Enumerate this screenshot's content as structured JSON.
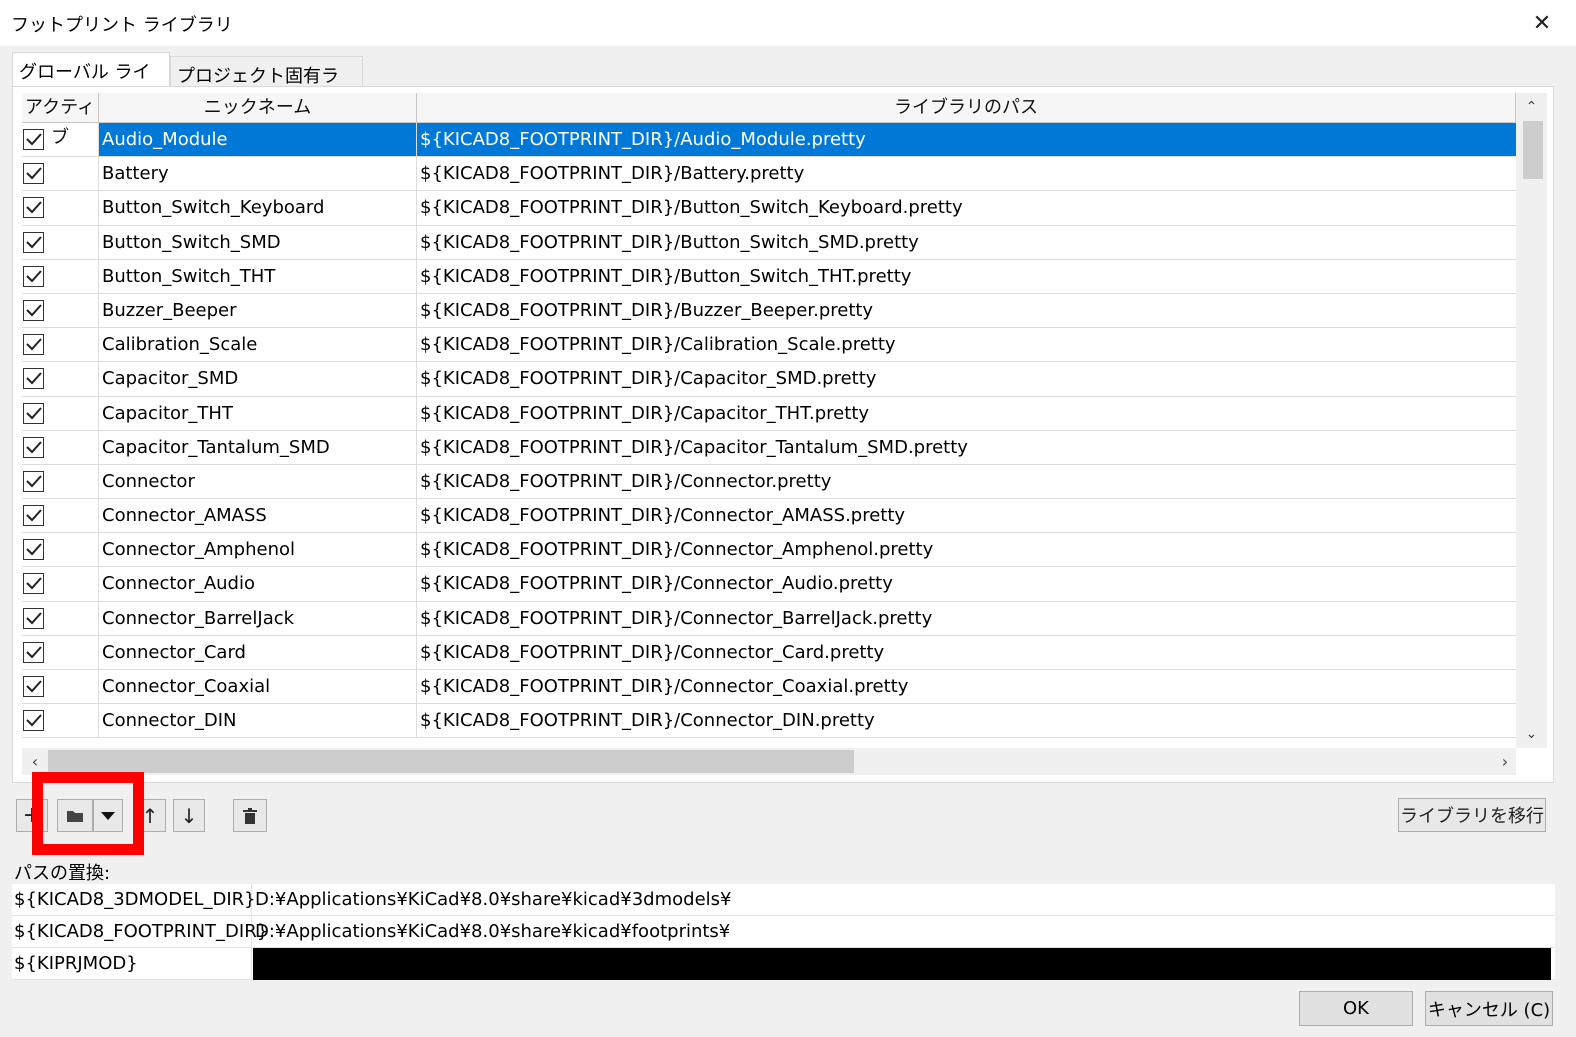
{
  "window": {
    "title": "フットプリント ライブラリ",
    "close_icon": "close-icon"
  },
  "tabs": [
    {
      "label": "グローバル ライブラリ",
      "active": true
    },
    {
      "label": "プロジェクト固有ライブラリ",
      "active": false
    }
  ],
  "table": {
    "headers": [
      "アクティブ",
      "ニックネーム",
      "ライブラリのパス"
    ],
    "rows": [
      {
        "active": true,
        "nickname": "Audio_Module",
        "path": "${KICAD8_FOOTPRINT_DIR}/Audio_Module.pretty",
        "selected": true
      },
      {
        "active": true,
        "nickname": "Battery",
        "path": "${KICAD8_FOOTPRINT_DIR}/Battery.pretty"
      },
      {
        "active": true,
        "nickname": "Button_Switch_Keyboard",
        "path": "${KICAD8_FOOTPRINT_DIR}/Button_Switch_Keyboard.pretty"
      },
      {
        "active": true,
        "nickname": "Button_Switch_SMD",
        "path": "${KICAD8_FOOTPRINT_DIR}/Button_Switch_SMD.pretty"
      },
      {
        "active": true,
        "nickname": "Button_Switch_THT",
        "path": "${KICAD8_FOOTPRINT_DIR}/Button_Switch_THT.pretty"
      },
      {
        "active": true,
        "nickname": "Buzzer_Beeper",
        "path": "${KICAD8_FOOTPRINT_DIR}/Buzzer_Beeper.pretty"
      },
      {
        "active": true,
        "nickname": "Calibration_Scale",
        "path": "${KICAD8_FOOTPRINT_DIR}/Calibration_Scale.pretty"
      },
      {
        "active": true,
        "nickname": "Capacitor_SMD",
        "path": "${KICAD8_FOOTPRINT_DIR}/Capacitor_SMD.pretty"
      },
      {
        "active": true,
        "nickname": "Capacitor_THT",
        "path": "${KICAD8_FOOTPRINT_DIR}/Capacitor_THT.pretty"
      },
      {
        "active": true,
        "nickname": "Capacitor_Tantalum_SMD",
        "path": "${KICAD8_FOOTPRINT_DIR}/Capacitor_Tantalum_SMD.pretty"
      },
      {
        "active": true,
        "nickname": "Connector",
        "path": "${KICAD8_FOOTPRINT_DIR}/Connector.pretty"
      },
      {
        "active": true,
        "nickname": "Connector_AMASS",
        "path": "${KICAD8_FOOTPRINT_DIR}/Connector_AMASS.pretty"
      },
      {
        "active": true,
        "nickname": "Connector_Amphenol",
        "path": "${KICAD8_FOOTPRINT_DIR}/Connector_Amphenol.pretty"
      },
      {
        "active": true,
        "nickname": "Connector_Audio",
        "path": "${KICAD8_FOOTPRINT_DIR}/Connector_Audio.pretty"
      },
      {
        "active": true,
        "nickname": "Connector_BarrelJack",
        "path": "${KICAD8_FOOTPRINT_DIR}/Connector_BarrelJack.pretty"
      },
      {
        "active": true,
        "nickname": "Connector_Card",
        "path": "${KICAD8_FOOTPRINT_DIR}/Connector_Card.pretty"
      },
      {
        "active": true,
        "nickname": "Connector_Coaxial",
        "path": "${KICAD8_FOOTPRINT_DIR}/Connector_Coaxial.pretty"
      },
      {
        "active": true,
        "nickname": "Connector_DIN",
        "path": "${KICAD8_FOOTPRINT_DIR}/Connector_DIN.pretty"
      }
    ]
  },
  "toolbar": {
    "add_icon": "plus-icon",
    "folder_icon": "folder-icon",
    "dropdown_icon": "chevron-down-icon",
    "up_icon": "arrow-up-icon",
    "down_icon": "arrow-down-icon",
    "delete_icon": "trash-icon",
    "migrate_label": "ライブラリを移行"
  },
  "path_substitution": {
    "label": "パスの置換:",
    "rows": [
      {
        "key": "${KICAD8_3DMODEL_DIR}",
        "value": "D:¥Applications¥KiCad¥8.0¥share¥kicad¥3dmodels¥"
      },
      {
        "key": "${KICAD8_FOOTPRINT_DIR}",
        "value": "D:¥Applications¥KiCad¥8.0¥share¥kicad¥footprints¥"
      },
      {
        "key": "${KIPRJMOD}",
        "value": "",
        "redacted": true
      }
    ]
  },
  "buttons": {
    "ok": "OK",
    "cancel": "キャンセル (C)"
  },
  "colors": {
    "selection": "#0078d7",
    "highlight_box": "#ff0000"
  }
}
